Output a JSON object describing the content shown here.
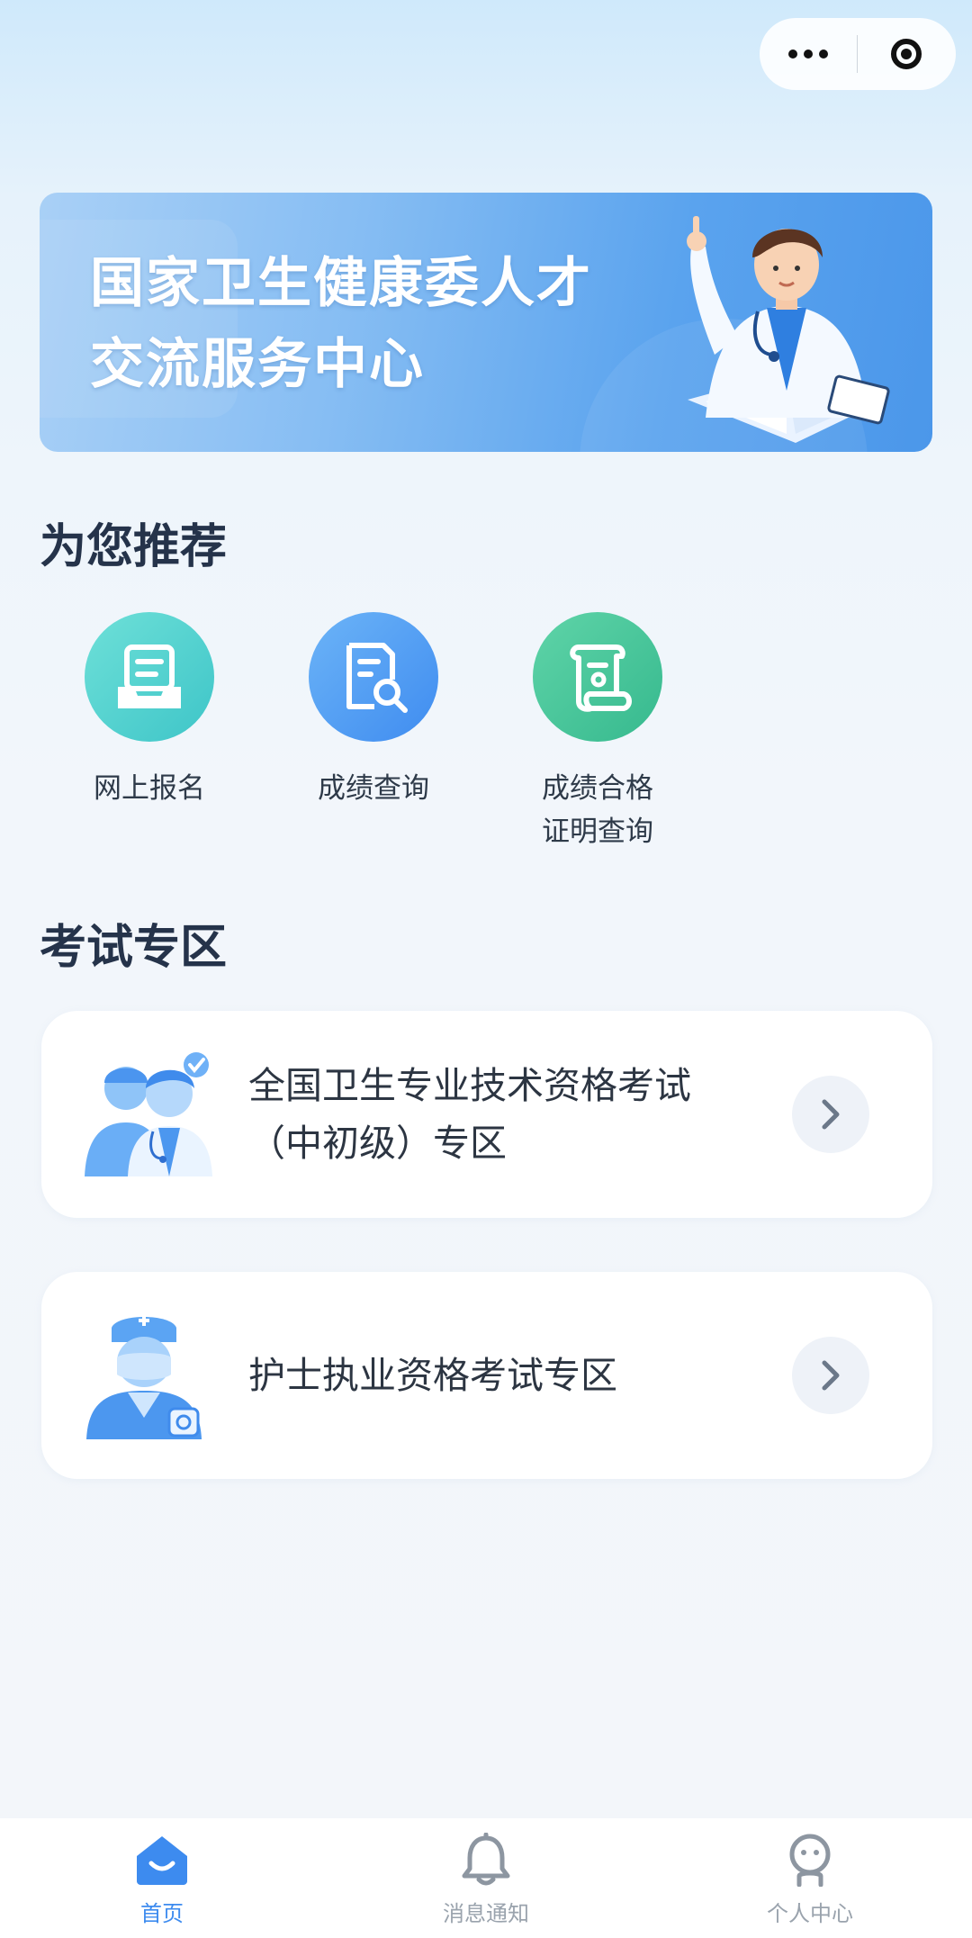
{
  "top_capsule": {
    "more_icon": "more-dots-icon",
    "close_icon": "target-close-icon"
  },
  "banner": {
    "title_line1": "国家卫生健康委人才",
    "title_line2": "交流服务中心"
  },
  "recommend": {
    "title": "为您推荐",
    "items": [
      {
        "label": "网上报名",
        "icon": "inbox-form-icon",
        "color": "#4fcfcd"
      },
      {
        "label": "成绩查询",
        "icon": "document-search-icon",
        "color": "#4f9bf3"
      },
      {
        "label": "成绩合格\n证明查询",
        "icon": "certificate-scroll-icon",
        "color": "#3fc3a0"
      }
    ]
  },
  "exam_zone": {
    "title": "考试专区",
    "cards": [
      {
        "label": "全国卫生专业技术资格考试（中初级）专区",
        "icon": "doctors-group-icon"
      },
      {
        "label": "护士执业资格考试专区",
        "icon": "nurse-icon"
      }
    ]
  },
  "tabbar": {
    "items": [
      {
        "label": "首页",
        "icon": "home-icon",
        "active": true
      },
      {
        "label": "消息通知",
        "icon": "bell-icon",
        "active": false
      },
      {
        "label": "个人中心",
        "icon": "person-icon",
        "active": false
      }
    ],
    "active_color": "#3d8bef",
    "inactive_color": "#9aa3ad"
  }
}
